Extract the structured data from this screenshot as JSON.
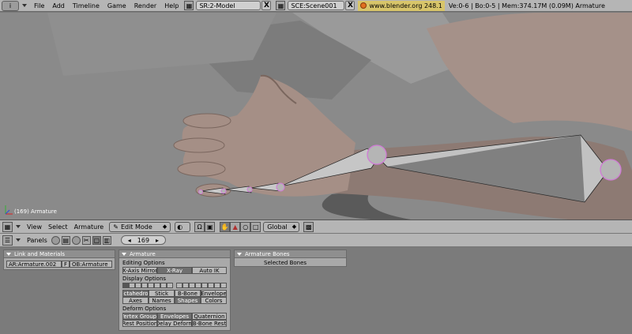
{
  "topbar": {
    "window_icon": "info-icon",
    "menus": [
      "File",
      "Add",
      "Timeline",
      "Game",
      "Render",
      "Help"
    ],
    "screen": "SR:2-Model",
    "scene": "SCE:Scene001",
    "close_glyph": "X",
    "url": "www.blender.org 248.1",
    "stats": "Ve:0-6 | Bo:0-5 | Mem:374.17M (0.09M) Armature"
  },
  "viewport": {
    "object_label": "(169) Armature"
  },
  "view_header": {
    "menus": [
      "View",
      "Select",
      "Armature"
    ],
    "mode": "Edit Mode",
    "orientation": "Global"
  },
  "buttons_header": {
    "panels_label": "Panels",
    "frame": "169"
  },
  "panels": {
    "link": {
      "title": "Link and Materials",
      "armature_field": "AR:Armature.002",
      "f_label": "F",
      "object_field": "OB:Armature"
    },
    "armature": {
      "title": "Armature",
      "editing_label": "Editing Options",
      "editing": [
        "X-Axis Mirror",
        "X-Ray",
        "Auto IK"
      ],
      "display_label": "Display Options",
      "display_row1": [
        "Octahedron",
        "Stick",
        "B-Bone",
        "Envelope"
      ],
      "display_row2": [
        "Axes",
        "Names",
        "Shapes",
        "Colors"
      ],
      "deform_label": "Deform Options",
      "deform_row1": [
        "Vertex Groups",
        "Envelopes",
        "Quaternion"
      ],
      "deform_row2": [
        "Rest Position",
        "Delay Deform",
        "B-Bone Rest"
      ]
    },
    "bones": {
      "title": "Armature Bones",
      "content": "Selected Bones"
    }
  },
  "colors": {
    "skin": "#a58f86",
    "bone_selected": "#d07ad6",
    "background": "#8a8a8a"
  }
}
